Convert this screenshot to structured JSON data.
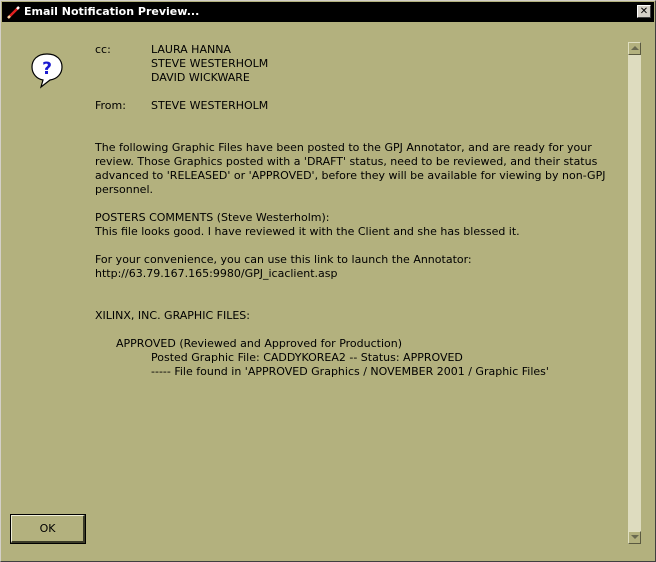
{
  "window": {
    "title": "Email Notification Preview...",
    "close_glyph": "✕"
  },
  "icons": {
    "title_icon": "pencil-icon",
    "message_icon": "question-icon"
  },
  "email": {
    "cc_label": "cc:",
    "cc": [
      "LAURA HANNA",
      "STEVE WESTERHOLM",
      "DAVID WICKWARE"
    ],
    "from_label": "From:",
    "from": "STEVE WESTERHOLM",
    "intro": [
      "The following Graphic Files have been posted to the GPJ Annotator, and are ready for your",
      "review.  Those Graphics posted with a 'DRAFT' status, need to be reviewed, and their status",
      "advanced to 'RELEASED' or 'APPROVED', before they will be available for viewing by non-GPJ",
      "personnel."
    ],
    "posters_heading": "POSTERS COMMENTS (Steve Westerholm):",
    "posters_comment": "This file looks good.  I have reviewed it with the Client and she has blessed it.",
    "link_intro": "For your convenience, you can use this link to launch the Annotator:",
    "link_url": "http://63.79.167.165:9980/GPJ_icaclient.asp",
    "client_heading": "XILINX, INC. GRAPHIC FILES:",
    "approved_heading": "APPROVED  (Reviewed and Approved for Production)",
    "posted_file_line": "Posted Graphic File:  CADDYKOREA2 -- Status:  APPROVED",
    "found_line": "----- File found in 'APPROVED Graphics / NOVEMBER 2001 / Graphic Files'"
  },
  "buttons": {
    "ok_label": "OK"
  }
}
